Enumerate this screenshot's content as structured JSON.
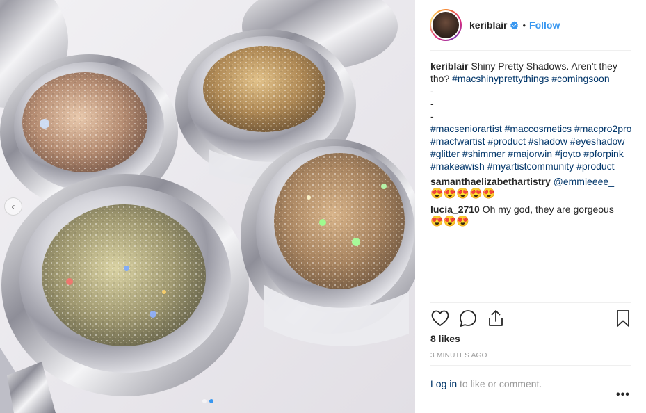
{
  "post": {
    "username": "keriblair",
    "follow_label": "Follow",
    "bullet": "•"
  },
  "caption": {
    "username": "keriblair",
    "line1": "Shiny Pretty Shadows. Aren't they tho? ",
    "tags1": [
      "#macshinyprettythings",
      "#comingsoon"
    ],
    "dashes": [
      "-",
      "-",
      "-"
    ],
    "tags2": [
      "#macseniorartist",
      "#maccosmetics",
      "#macpro2pro",
      "#macfwartist",
      "#product",
      "#shadow",
      "#eyeshadow",
      "#glitter",
      "#shimmer",
      "#majorwin",
      "#joyto",
      "#pforpink",
      "#makeawish",
      "#myartistcommunity",
      "#product"
    ]
  },
  "comments": [
    {
      "username": "samanthaelizabethartistry",
      "text": "@emmieeee_",
      "emojis": "😍😍😍😍😍"
    },
    {
      "username": "lucia_2710",
      "text": "Oh my god, they are gorgeous",
      "emojis": "😍😍😍"
    }
  ],
  "likes": "8 likes",
  "timestamp": "3 MINUTES AGO",
  "login": {
    "link": "Log in",
    "rest": " to like or comment."
  },
  "more_label": "•••",
  "icons": [
    "heart-icon",
    "comment-icon",
    "share-icon",
    "bookmark-icon",
    "verified-badge-icon",
    "chevron-left-icon"
  ],
  "colors": {
    "link": "#3897f0",
    "hashtag": "#003569",
    "muted": "#999999"
  },
  "carousel": {
    "slides": 2,
    "active": 1
  }
}
